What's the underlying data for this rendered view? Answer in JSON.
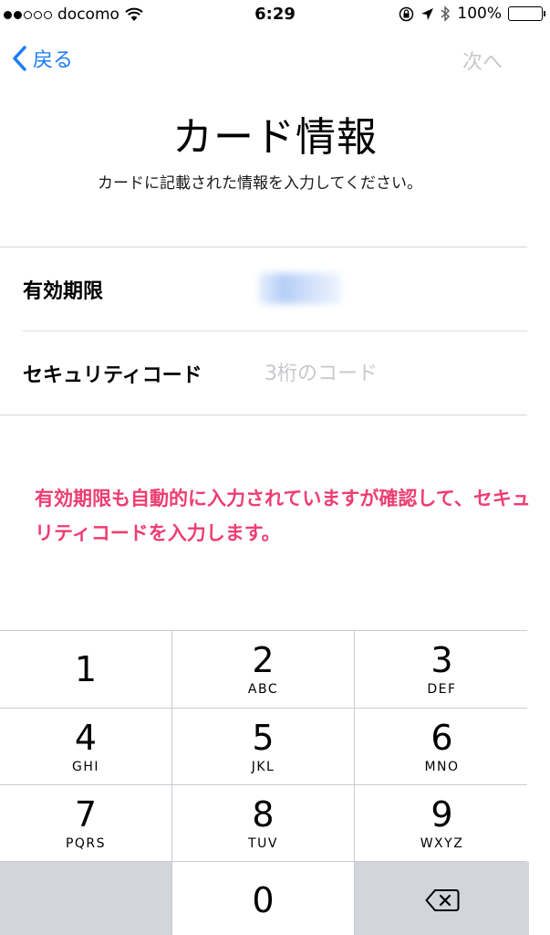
{
  "status_bar": {
    "carrier": "docomo",
    "time": "6:29",
    "battery": "100%"
  },
  "nav": {
    "back_label": "戻る",
    "next_label": "次へ"
  },
  "title": "カード情報",
  "subtitle": "カードに記載された情報を入力してください。",
  "form": {
    "expiry_label": "有効期限",
    "security_label": "セキュリティコード",
    "security_placeholder": "3桁のコード"
  },
  "annotation": "有効期限も自動的に入力されていますが確認して、セキュリティコードを入力します。",
  "keypad": {
    "keys": [
      {
        "digit": "1",
        "letters": ""
      },
      {
        "digit": "2",
        "letters": "ABC"
      },
      {
        "digit": "3",
        "letters": "DEF"
      },
      {
        "digit": "4",
        "letters": "GHI"
      },
      {
        "digit": "5",
        "letters": "JKL"
      },
      {
        "digit": "6",
        "letters": "MNO"
      },
      {
        "digit": "7",
        "letters": "PQRS"
      },
      {
        "digit": "8",
        "letters": "TUV"
      },
      {
        "digit": "9",
        "letters": "WXYZ"
      },
      {
        "digit": "0",
        "letters": ""
      }
    ]
  },
  "colors": {
    "accent": "#1a7cf6",
    "annotation": "#ee3d72",
    "disabled": "#c8c8cc"
  }
}
